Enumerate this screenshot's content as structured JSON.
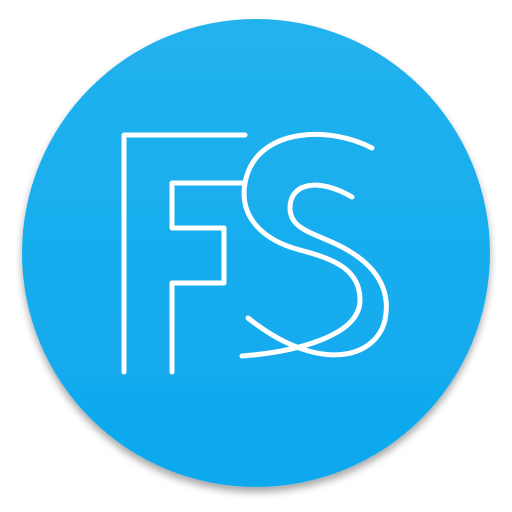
{
  "icon": {
    "name": "fs-logo-icon",
    "logo_text": "FS",
    "colors": {
      "circle_top": "#22B2EE",
      "circle_bottom": "#0DA8EE",
      "stroke": "#FFFFFF",
      "shadow": "#6E8EA0"
    }
  }
}
